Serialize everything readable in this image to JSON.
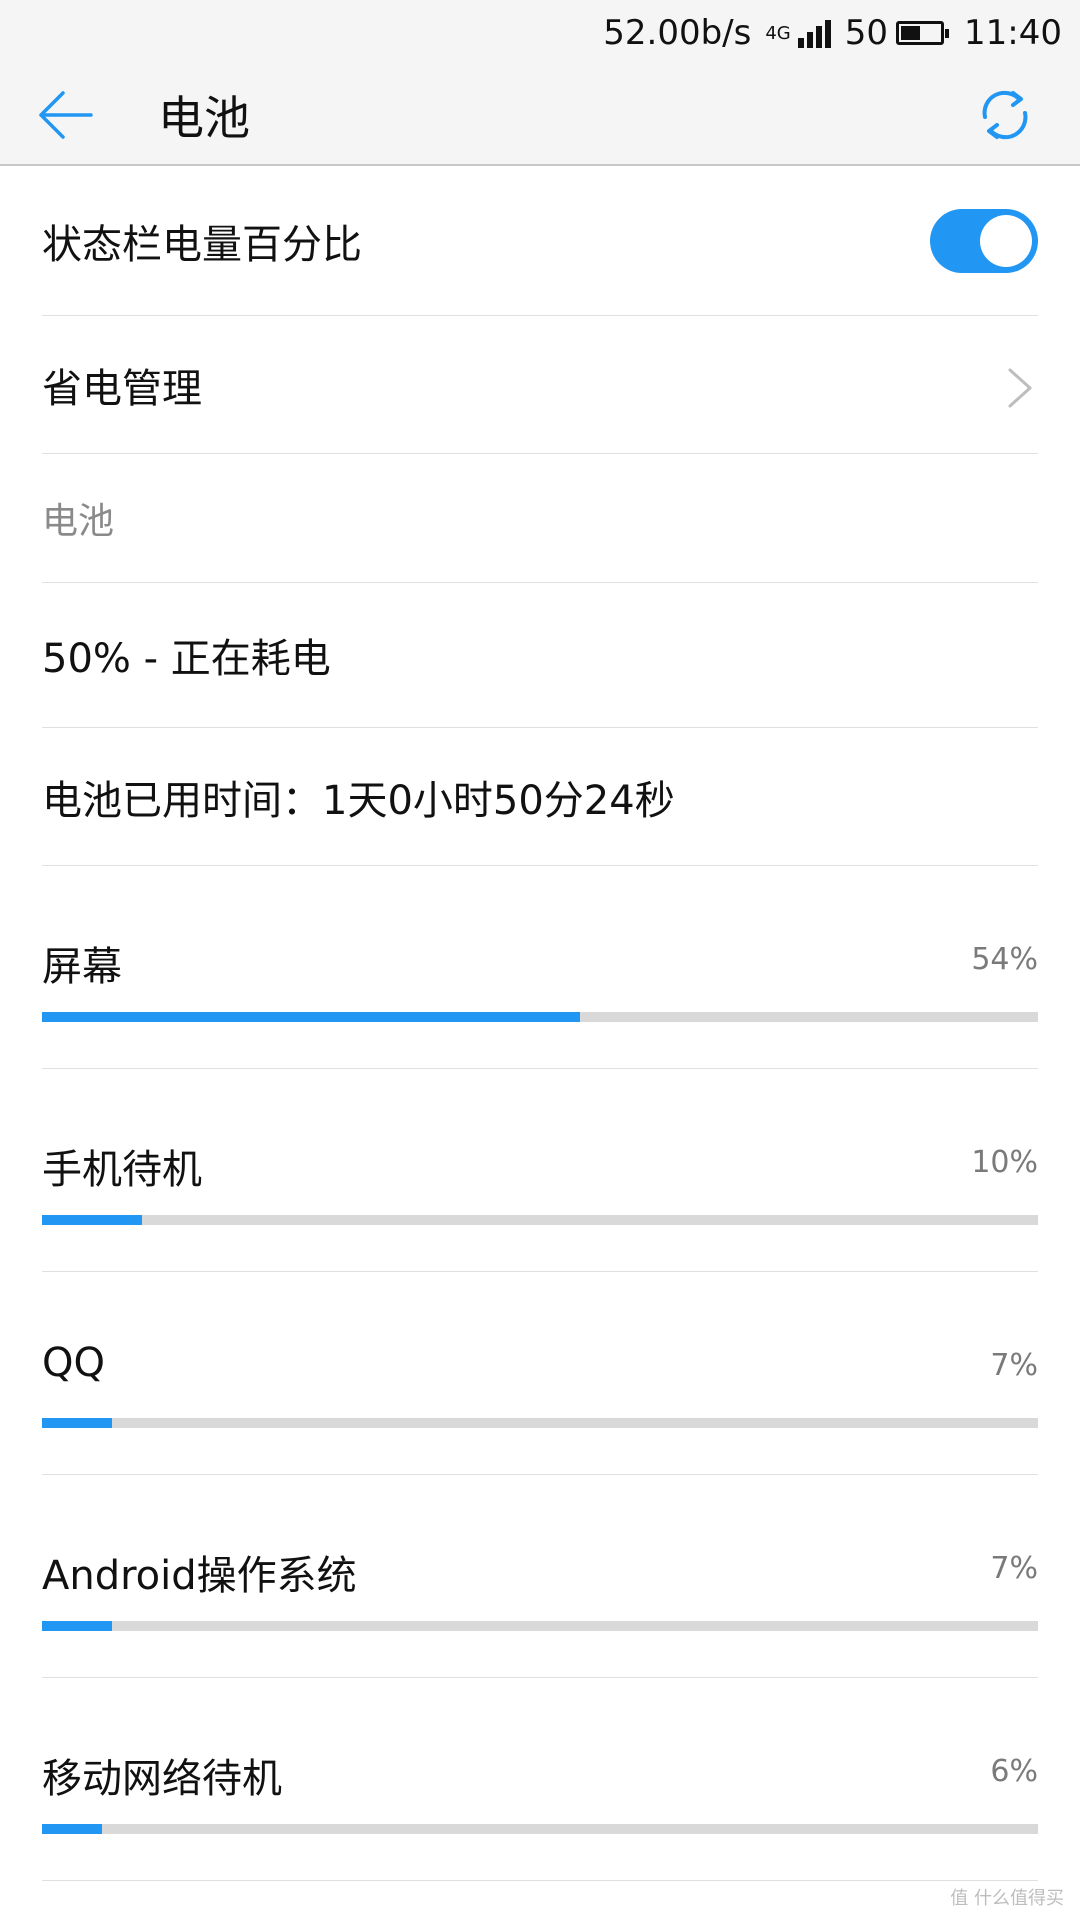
{
  "status_bar": {
    "speed": "52.00b/s",
    "network": "4G",
    "battery_level": "50",
    "battery_fraction": 0.5,
    "time": "11:40"
  },
  "app_bar": {
    "title": "电池",
    "back_icon": "arrow-left-icon",
    "refresh_icon": "refresh-icon",
    "accent_color": "#2196f3"
  },
  "settings": {
    "percentage_toggle": {
      "label": "状态栏电量百分比",
      "on": true
    },
    "power_saving": {
      "label": "省电管理"
    },
    "section_header": "电池",
    "battery_status": "50% - 正在耗电",
    "battery_used_time": "电池已用时间：1天0小时50分24秒"
  },
  "usage": [
    {
      "name": "屏幕",
      "percent": "54%",
      "value": 54
    },
    {
      "name": "手机待机",
      "percent": "10%",
      "value": 10
    },
    {
      "name": "QQ",
      "percent": "7%",
      "value": 7
    },
    {
      "name": "Android操作系统",
      "percent": "7%",
      "value": 7
    },
    {
      "name": "移动网络待机",
      "percent": "6%",
      "value": 6
    }
  ],
  "watermark": "值 什么值得买"
}
